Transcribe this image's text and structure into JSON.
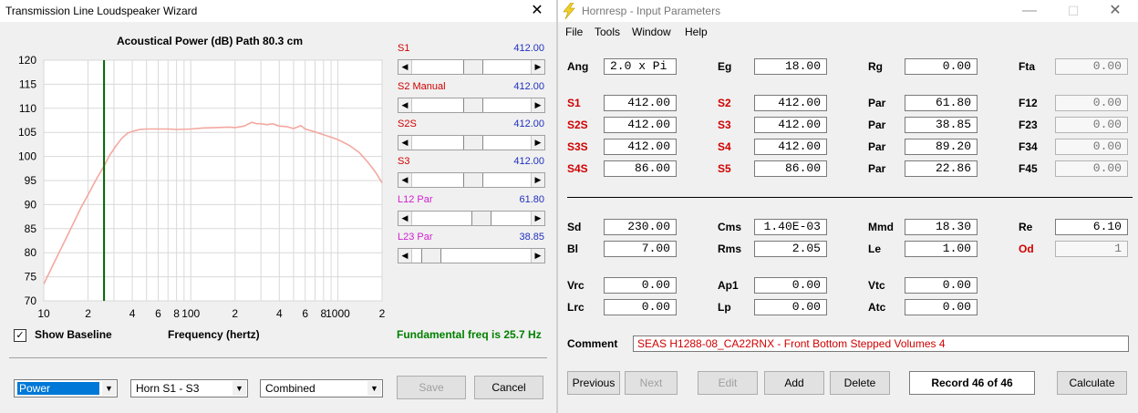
{
  "wizard": {
    "title": "Transmission Line Loudspeaker Wizard",
    "close_glyph": "✕",
    "chart_title": "Acoustical Power (dB)   Path 80.3 cm",
    "sliders": [
      {
        "name": "S1",
        "value": "412.00",
        "color": "#d00000",
        "fraction": 0.52
      },
      {
        "name": "S2  Manual",
        "value": "412.00",
        "color": "#d00000",
        "fraction": 0.52
      },
      {
        "name": "S2S",
        "value": "412.00",
        "color": "#d00000",
        "fraction": 0.52
      },
      {
        "name": "S3",
        "value": "412.00",
        "color": "#d00000",
        "fraction": 0.52
      },
      {
        "name": "L12  Par",
        "value": "61.80",
        "color": "#d020d0",
        "fraction": 0.6
      },
      {
        "name": "L23  Par",
        "value": "38.85",
        "color": "#d020d0",
        "fraction": 0.1
      }
    ],
    "show_baseline_label": "Show Baseline",
    "show_baseline_checked": true,
    "check_glyph": "✓",
    "fundamental_text": "Fundamental freq is 25.7 Hz",
    "combo_type": "Power",
    "combo_horn": "Horn S1 - S3",
    "combo_mode": "Combined",
    "save_label": "Save",
    "cancel_label": "Cancel",
    "dropdown_glyph": "▼",
    "arrow_left": "◀",
    "arrow_right": "▶"
  },
  "chart_data": {
    "type": "line",
    "title": "Acoustical Power (dB)   Path 80.3 cm",
    "xlabel": "Frequency (hertz)",
    "ylabel": "",
    "x_scale": "log",
    "xlim": [
      10,
      2000
    ],
    "ylim": [
      70,
      120
    ],
    "y_ticks": [
      "120",
      "115",
      "110",
      "105",
      "100",
      "95",
      "90",
      "85",
      "80",
      "75",
      "70"
    ],
    "x_tick_labels": [
      {
        "value": 10,
        "label": "10"
      },
      {
        "value": 20,
        "label": "2"
      },
      {
        "value": 40,
        "label": "4"
      },
      {
        "value": 60,
        "label": "6"
      },
      {
        "value": 80,
        "label": "8"
      },
      {
        "value": 100,
        "label": "100"
      },
      {
        "value": 200,
        "label": "2"
      },
      {
        "value": 400,
        "label": "4"
      },
      {
        "value": 600,
        "label": "6"
      },
      {
        "value": 800,
        "label": "8"
      },
      {
        "value": 1000,
        "label": "1000"
      },
      {
        "value": 2000,
        "label": "2"
      }
    ],
    "grid": true,
    "marker_frequency": 25.7,
    "series": [
      {
        "color": "#f4a8a0",
        "x": [
          10,
          12,
          15,
          18,
          20,
          23,
          25.7,
          28,
          31,
          34,
          37,
          40,
          45,
          50,
          60,
          70,
          80,
          100,
          120,
          150,
          180,
          200,
          230,
          260,
          280,
          300,
          330,
          360,
          400,
          450,
          500,
          560,
          600,
          700,
          800,
          900,
          1000,
          1200,
          1400,
          1600,
          1800,
          2000
        ],
        "y": [
          73.5,
          78.5,
          84.5,
          89.5,
          92,
          95.5,
          98,
          100.2,
          102.2,
          103.8,
          104.8,
          105.2,
          105.6,
          105.7,
          105.7,
          105.7,
          105.6,
          105.7,
          105.9,
          106.0,
          106.1,
          106.0,
          106.3,
          107.1,
          106.8,
          106.8,
          106.6,
          106.8,
          106.3,
          106.2,
          105.8,
          106.4,
          105.7,
          105.1,
          104.5,
          104.0,
          103.5,
          102.3,
          100.8,
          98.8,
          96.8,
          94.5
        ]
      }
    ]
  },
  "hornresp": {
    "title": "Hornresp - Input Parameters",
    "min_glyph": "—",
    "max_glyph": "☐",
    "close_glyph": "✕",
    "menu": [
      "File",
      "Tools",
      "Window",
      "Help"
    ],
    "rows1": [
      {
        "l1": "Ang",
        "v1": "2.0 x Pi",
        "l2": "Eg",
        "v2": "18.00",
        "l3": "Rg",
        "v3": "0.00",
        "l4": "Fta",
        "v4": "0.00"
      },
      {
        "l1": "S1",
        "v1": "412.00",
        "l2": "S2",
        "v2": "412.00",
        "l3": "Par",
        "v3": "61.80",
        "l4": "F12",
        "v4": "0.00"
      },
      {
        "l1": "S2S",
        "v1": "412.00",
        "l2": "S3",
        "v2": "412.00",
        "l3": "Par",
        "v3": "38.85",
        "l4": "F23",
        "v4": "0.00"
      },
      {
        "l1": "S3S",
        "v1": "412.00",
        "l2": "S4",
        "v2": "412.00",
        "l3": "Par",
        "v3": "89.20",
        "l4": "F34",
        "v4": "0.00"
      },
      {
        "l1": "S4S",
        "v1": "86.00",
        "l2": "S5",
        "v2": "86.00",
        "l3": "Par",
        "v3": "22.86",
        "l4": "F45",
        "v4": "0.00"
      }
    ],
    "rows2": [
      {
        "l1": "Sd",
        "v1": "230.00",
        "l2": "Cms",
        "v2": "1.40E-03",
        "l3": "Mmd",
        "v3": "18.30",
        "l4": "Re",
        "v4": "6.10"
      },
      {
        "l1": "Bl",
        "v1": "7.00",
        "l2": "Rms",
        "v2": "2.05",
        "l3": "Le",
        "v3": "1.00",
        "l4": "Od",
        "v4": "1"
      }
    ],
    "rows3": [
      {
        "l1": "Vrc",
        "v1": "0.00",
        "l2": "Ap1",
        "v2": "0.00",
        "l3": "Vtc",
        "v3": "0.00"
      },
      {
        "l1": "Lrc",
        "v1": "0.00",
        "l2": "Lp",
        "v2": "0.00",
        "l3": "Atc",
        "v3": "0.00"
      }
    ],
    "comment_label": "Comment",
    "comment_value": "SEAS H1288-08_CA22RNX - Front Bottom Stepped Volumes 4",
    "buttons": {
      "previous": "Previous",
      "next": "Next",
      "edit": "Edit",
      "add": "Add",
      "delete": "Delete",
      "record": "Record 46 of 46",
      "calculate": "Calculate"
    }
  },
  "colors": {
    "red_label": "#d00000",
    "blue_value": "#2030c0",
    "green_text": "#008000",
    "marker_line": "#006400",
    "curve": "#f4a8a0",
    "lightning": "#f2d024"
  }
}
